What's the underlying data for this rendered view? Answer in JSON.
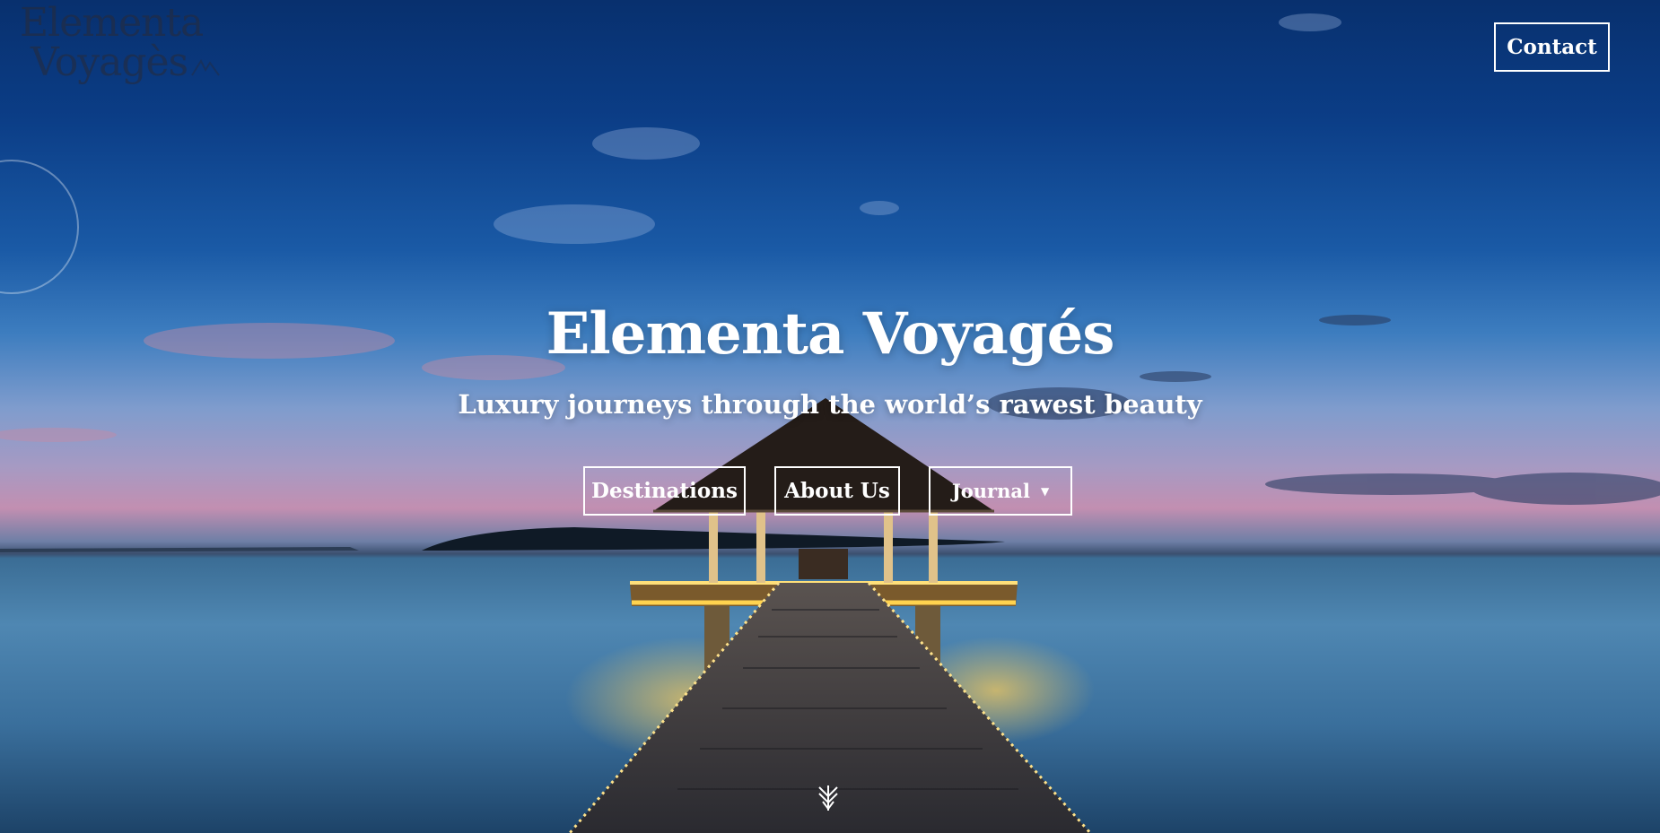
{
  "site": {
    "logo_line1": "Elementa",
    "logo_line2": "Voyagès",
    "contact_label": "Contact"
  },
  "hero": {
    "title": "Elementa Voyagés",
    "tagline": "Luxury journeys through the world’s rawest beauty"
  },
  "nav": {
    "destinations_label": "Destinations",
    "about_label": "About Us",
    "journal_label": "Journal"
  },
  "icons": {
    "scroll_down": "chevron-down-icon",
    "journal_caret": "caret-down-icon",
    "logo_mark": "logo-mark-icon"
  },
  "colors": {
    "text": "#ffffff",
    "button_border": "#ffffff",
    "sky_top": "#08306e",
    "sea": "#4f87b2",
    "light_glow": "#ffd24a"
  }
}
